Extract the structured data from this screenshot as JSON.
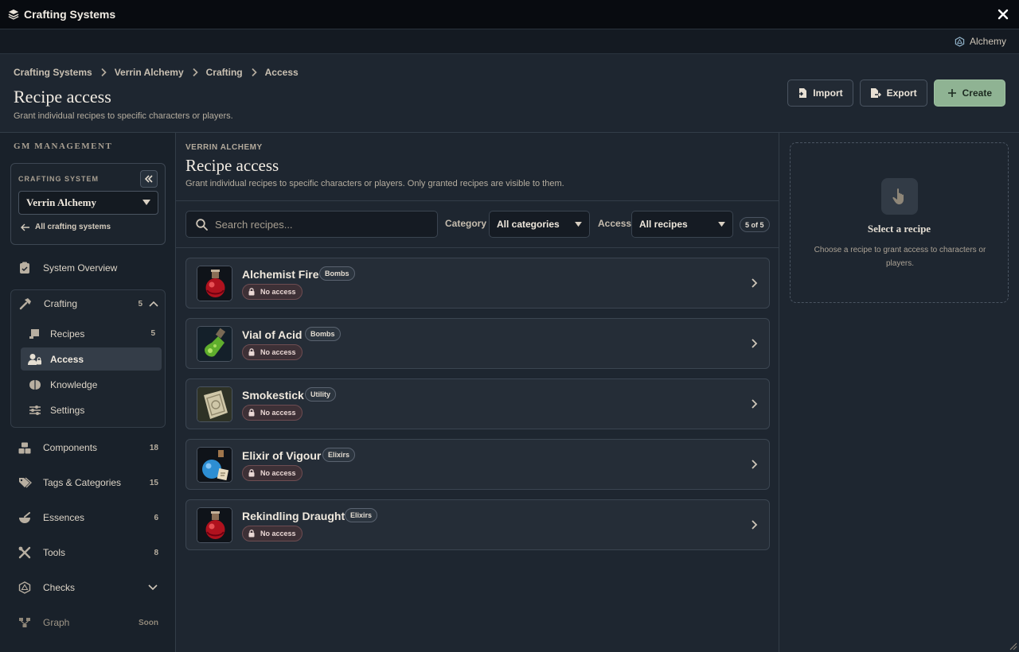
{
  "window": {
    "title": "Crafting Systems"
  },
  "strip": {
    "system_name": "Alchemy"
  },
  "breadcrumb": [
    "Crafting Systems",
    "Verrin Alchemy",
    "Crafting",
    "Access"
  ],
  "header": {
    "title": "Recipe access",
    "subtitle": "Grant individual recipes to specific characters or players.",
    "import_label": "Import",
    "export_label": "Export",
    "create_label": "Create"
  },
  "sidebar": {
    "section_label": "GM MANAGEMENT",
    "system_caption": "CRAFTING SYSTEM",
    "system_value": "Verrin Alchemy",
    "back_label": "All crafting systems",
    "overview_label": "System Overview",
    "crafting": {
      "label": "Crafting",
      "count": "5"
    },
    "crafting_sub": [
      {
        "label": "Recipes",
        "count": "5"
      },
      {
        "label": "Access",
        "count": ""
      },
      {
        "label": "Knowledge",
        "count": ""
      },
      {
        "label": "Settings",
        "count": ""
      }
    ],
    "items": [
      {
        "label": "Components",
        "count": "18"
      },
      {
        "label": "Tags & Categories",
        "count": "15"
      },
      {
        "label": "Essences",
        "count": "6"
      },
      {
        "label": "Tools",
        "count": "8"
      },
      {
        "label": "Checks",
        "count": ""
      },
      {
        "label": "Graph",
        "count": "Soon"
      }
    ]
  },
  "main": {
    "eyebrow": "VERRIN ALCHEMY",
    "title": "Recipe access",
    "subtitle": "Grant individual recipes to specific characters or players. Only granted recipes are visible to them.",
    "search_placeholder": "Search recipes...",
    "category_label": "Category",
    "category_value": "All categories",
    "access_label": "Access",
    "access_value": "All recipes",
    "count": "5 of 5"
  },
  "recipes": [
    {
      "name": "Alchemist Fire",
      "tag": "Bombs",
      "access": "No access",
      "icon": "red-potion-icon"
    },
    {
      "name": "Vial of Acid",
      "tag": "Bombs",
      "access": "No access",
      "icon": "green-vial-icon"
    },
    {
      "name": "Smokestick",
      "tag": "Utility",
      "access": "No access",
      "icon": "smoke-scroll-icon"
    },
    {
      "name": "Elixir of Vigour",
      "tag": "Elixirs",
      "access": "No access",
      "icon": "blue-elixir-icon"
    },
    {
      "name": "Rekindling Draught",
      "tag": "Elixirs",
      "access": "No access",
      "icon": "red-potion-icon"
    }
  ],
  "panel": {
    "title": "Select a recipe",
    "description": "Choose a recipe to grant access to characters or players."
  },
  "colors": {
    "accent": "#8fb393",
    "no_access_bg": "#3d3036",
    "background": "#1e2630"
  }
}
